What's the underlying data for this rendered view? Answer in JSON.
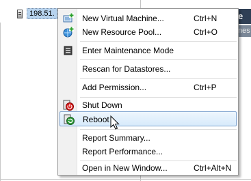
{
  "host": {
    "label": "198.51."
  },
  "right_pane": {
    "header_fragment": "re",
    "tab_fragment": "nes"
  },
  "menu": {
    "items": [
      {
        "label": "New Virtual Machine...",
        "shortcut": "Ctrl+N",
        "icon": "new-vm-icon"
      },
      {
        "label": "New Resource Pool...",
        "shortcut": "Ctrl+O",
        "icon": "new-resource-pool-icon"
      },
      {
        "label": "Enter Maintenance Mode",
        "shortcut": "",
        "icon": "maintenance-icon"
      },
      {
        "label": "Rescan for Datastores...",
        "shortcut": "",
        "icon": ""
      },
      {
        "label": "Add Permission...",
        "shortcut": "Ctrl+P",
        "icon": ""
      },
      {
        "label": "Shut Down",
        "shortcut": "",
        "icon": "shutdown-icon"
      },
      {
        "label": "Reboot",
        "shortcut": "",
        "icon": "reboot-icon",
        "highlighted": true
      },
      {
        "label": "Report Summary...",
        "shortcut": "",
        "icon": ""
      },
      {
        "label": "Report Performance...",
        "shortcut": "",
        "icon": ""
      },
      {
        "label": "Open in New Window...",
        "shortcut": "Ctrl+Alt+N",
        "icon": ""
      }
    ]
  },
  "colors": {
    "highlight_border": "#7da2ce",
    "host_selection": "#b7d3ee",
    "header_bg": "#2f3f55"
  }
}
